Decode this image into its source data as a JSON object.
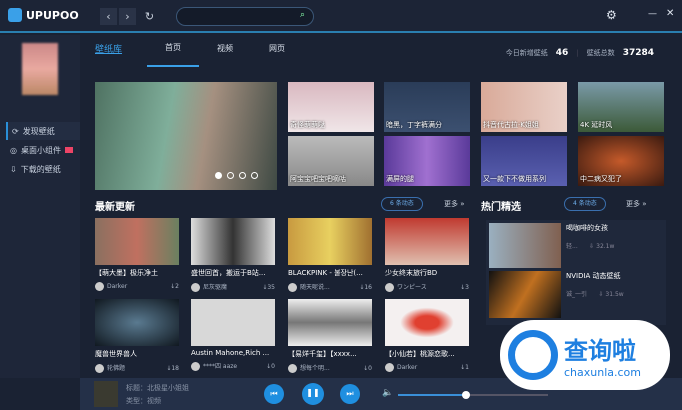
{
  "app": {
    "name": "UPUPOO",
    "back": "‹",
    "forward": "›",
    "refresh": "↻",
    "search_icon": "⌕",
    "settings": "⚙",
    "minimize": "—",
    "close": "✕"
  },
  "sidebar": {
    "items": [
      {
        "icon": "⟳",
        "label": "发现壁纸"
      },
      {
        "icon": "◎",
        "label": "桌面小组件"
      },
      {
        "icon": "⇩",
        "label": "下载的壁纸"
      }
    ]
  },
  "nav": {
    "brand": "壁纸库",
    "tabs": [
      "首页",
      "视频",
      "网页"
    ],
    "today_label": "今日新增壁纸",
    "today_value": "46",
    "total_label": "壁纸总数",
    "total_value": "37284"
  },
  "featured": [
    {
      "title": "奇怪萌萌哒"
    },
    {
      "title": "暗黑，丁字裤满分"
    },
    {
      "title": "抖音代古拉·K姐姐"
    },
    {
      "title": "4K 延时风"
    },
    {
      "title": "阿宝宝吧宝吧嘀咕"
    },
    {
      "title": "满屏的腿"
    },
    {
      "title": "又一款下不做用系列"
    },
    {
      "title": "中二病又犯了"
    }
  ],
  "latest": {
    "title": "最新更新",
    "refresh": "6 条动态",
    "more": "更多 »",
    "cards": [
      {
        "title": "【萌大墨】极乐净土",
        "author": "Darker",
        "downloads": "↓2"
      },
      {
        "title": "盛世回首，搬运于B站...",
        "author": "尼灰驱魔",
        "downloads": "↓35"
      },
      {
        "title": "BLACKPINK - 불장난(...",
        "author": "随天呢说...",
        "downloads": "↓16"
      },
      {
        "title": "少女终末旅行BD",
        "author": "ワンピース",
        "downloads": "↓3"
      },
      {
        "title": "魔兽世界兽人",
        "author": "轮佛题",
        "downloads": "↓18"
      },
      {
        "title": "Austin Mahone,Rich ...",
        "author": "****四 aaze",
        "downloads": "↓0"
      },
      {
        "title": "【易烊千玺】【xxxx...",
        "author": "想每个明...",
        "downloads": "↓0"
      },
      {
        "title": "【小仙若】桃源恋歌...",
        "author": "Darker",
        "downloads": "↓1"
      }
    ]
  },
  "hot": {
    "title": "热门精选",
    "refresh": "4 条动态",
    "more": "更多 »",
    "items": [
      {
        "title": "喝咖啡的女孩",
        "author": "轻...",
        "count": "32.1w"
      },
      {
        "title": "NVIDIA 动态壁纸",
        "author": "诚_一引",
        "count": "31.5w"
      }
    ]
  },
  "player": {
    "title": "标题：北极星小姐姐",
    "type": "类型：视频",
    "prev": "⏮",
    "pause": "❚❚",
    "next": "⏭",
    "volume_icon": "🔈",
    "volume": 0.45
  },
  "watermark": {
    "text": "查询啦",
    "url": "chaxunla.com"
  }
}
